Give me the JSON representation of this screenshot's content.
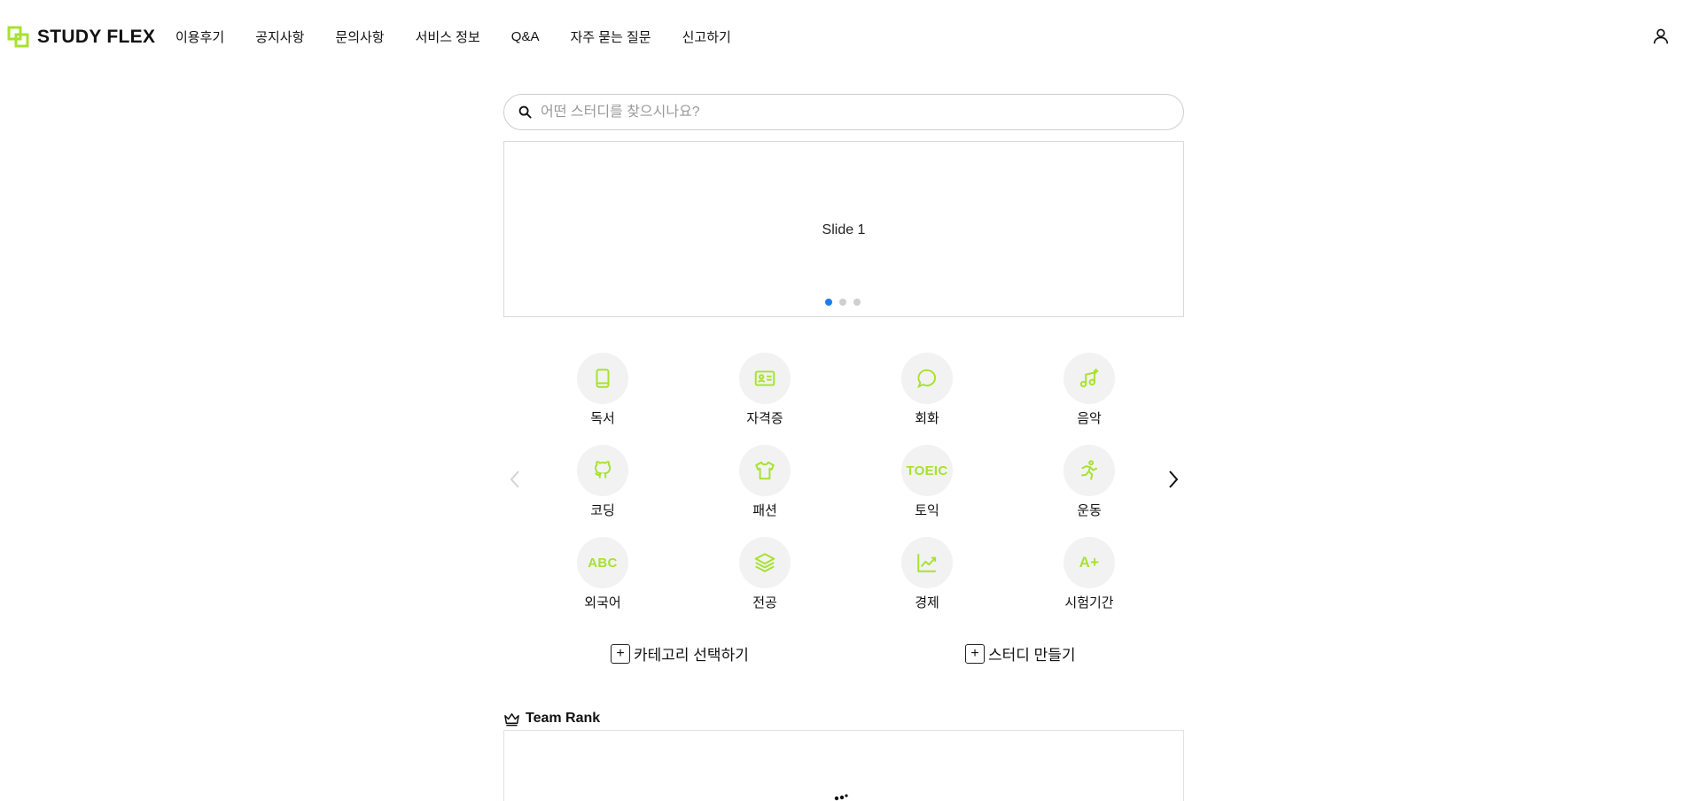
{
  "brand": {
    "name": "STUDY FLEX",
    "accent": "#a6e22e"
  },
  "nav": {
    "items": [
      {
        "label": "이용후기"
      },
      {
        "label": "공지사항"
      },
      {
        "label": "문의사항"
      },
      {
        "label": "서비스 정보"
      },
      {
        "label": "Q&A"
      },
      {
        "label": "자주 묻는 질문"
      },
      {
        "label": "신고하기"
      }
    ],
    "user_icon": "user-icon"
  },
  "search": {
    "placeholder": "어떤 스터디를 찾으시나요?",
    "value": ""
  },
  "slider": {
    "current_label": "Slide 1",
    "dots": [
      {
        "active": true
      },
      {
        "active": false
      },
      {
        "active": false
      }
    ],
    "active_color": "#1a7cf0"
  },
  "categories": {
    "items": [
      {
        "label": "독서",
        "icon": "book-icon"
      },
      {
        "label": "자격증",
        "icon": "id-card-icon"
      },
      {
        "label": "회화",
        "icon": "chat-bubble-icon"
      },
      {
        "label": "음악",
        "icon": "music-note-icon"
      },
      {
        "label": "코딩",
        "icon": "github-cat-icon"
      },
      {
        "label": "패션",
        "icon": "tshirt-icon"
      },
      {
        "label": "토익",
        "icon": "toeic-text-icon",
        "icon_text": "TOEIC"
      },
      {
        "label": "운동",
        "icon": "running-person-icon"
      },
      {
        "label": "외국어",
        "icon": "abc-text-icon",
        "icon_text": "ABC"
      },
      {
        "label": "전공",
        "icon": "layers-icon"
      },
      {
        "label": "경제",
        "icon": "chart-line-icon"
      },
      {
        "label": "시험기간",
        "icon": "a-plus-text-icon",
        "icon_text": "A+"
      }
    ]
  },
  "actions": {
    "select_category": "카테고리 선택하기",
    "create_study": "스터디 만들기"
  },
  "team_rank": {
    "title": "Team Rank"
  }
}
